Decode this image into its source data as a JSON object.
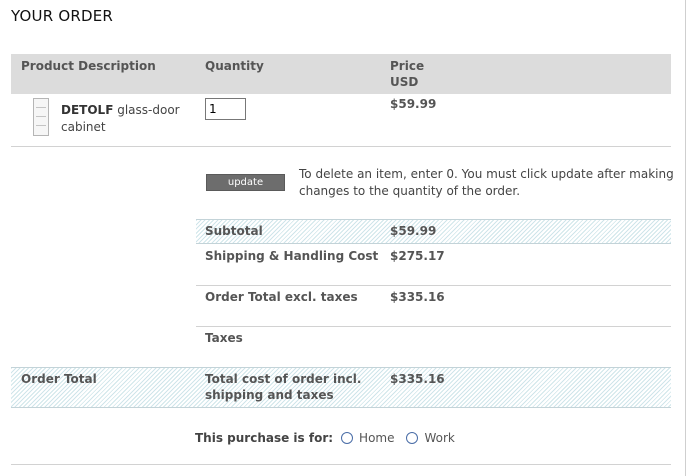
{
  "page": {
    "title": "YOUR ORDER"
  },
  "table_header": {
    "description": "Product Description",
    "quantity": "Quantity",
    "price_line1": "Price",
    "price_line2": "USD"
  },
  "item": {
    "brand": "DETOLF",
    "name": "glass-door cabinet",
    "quantity": "1",
    "price": "$59.99"
  },
  "update": {
    "button_label": "update",
    "help_text": "To delete an item, enter 0. You must click update after making changes to the quantity of the order."
  },
  "summary": {
    "subtotal_label": "Subtotal",
    "subtotal_value": "$59.99",
    "shipping_label": "Shipping & Handling Cost",
    "shipping_value": "$275.17",
    "excl_label": "Order Total excl. taxes",
    "excl_value": "$335.16",
    "taxes_label": "Taxes",
    "taxes_value": ""
  },
  "order_total": {
    "label": "Order Total",
    "desc": "Total cost of order incl. shipping and taxes",
    "value": "$335.16"
  },
  "purchase": {
    "label": "This purchase is for:",
    "option_home": "Home",
    "option_work": "Work"
  },
  "colors": {
    "header_band": "#dcdcdc",
    "stripe": "#cfe5ea",
    "radio_border": "#4a6da7",
    "button": "#6d6d6d"
  }
}
